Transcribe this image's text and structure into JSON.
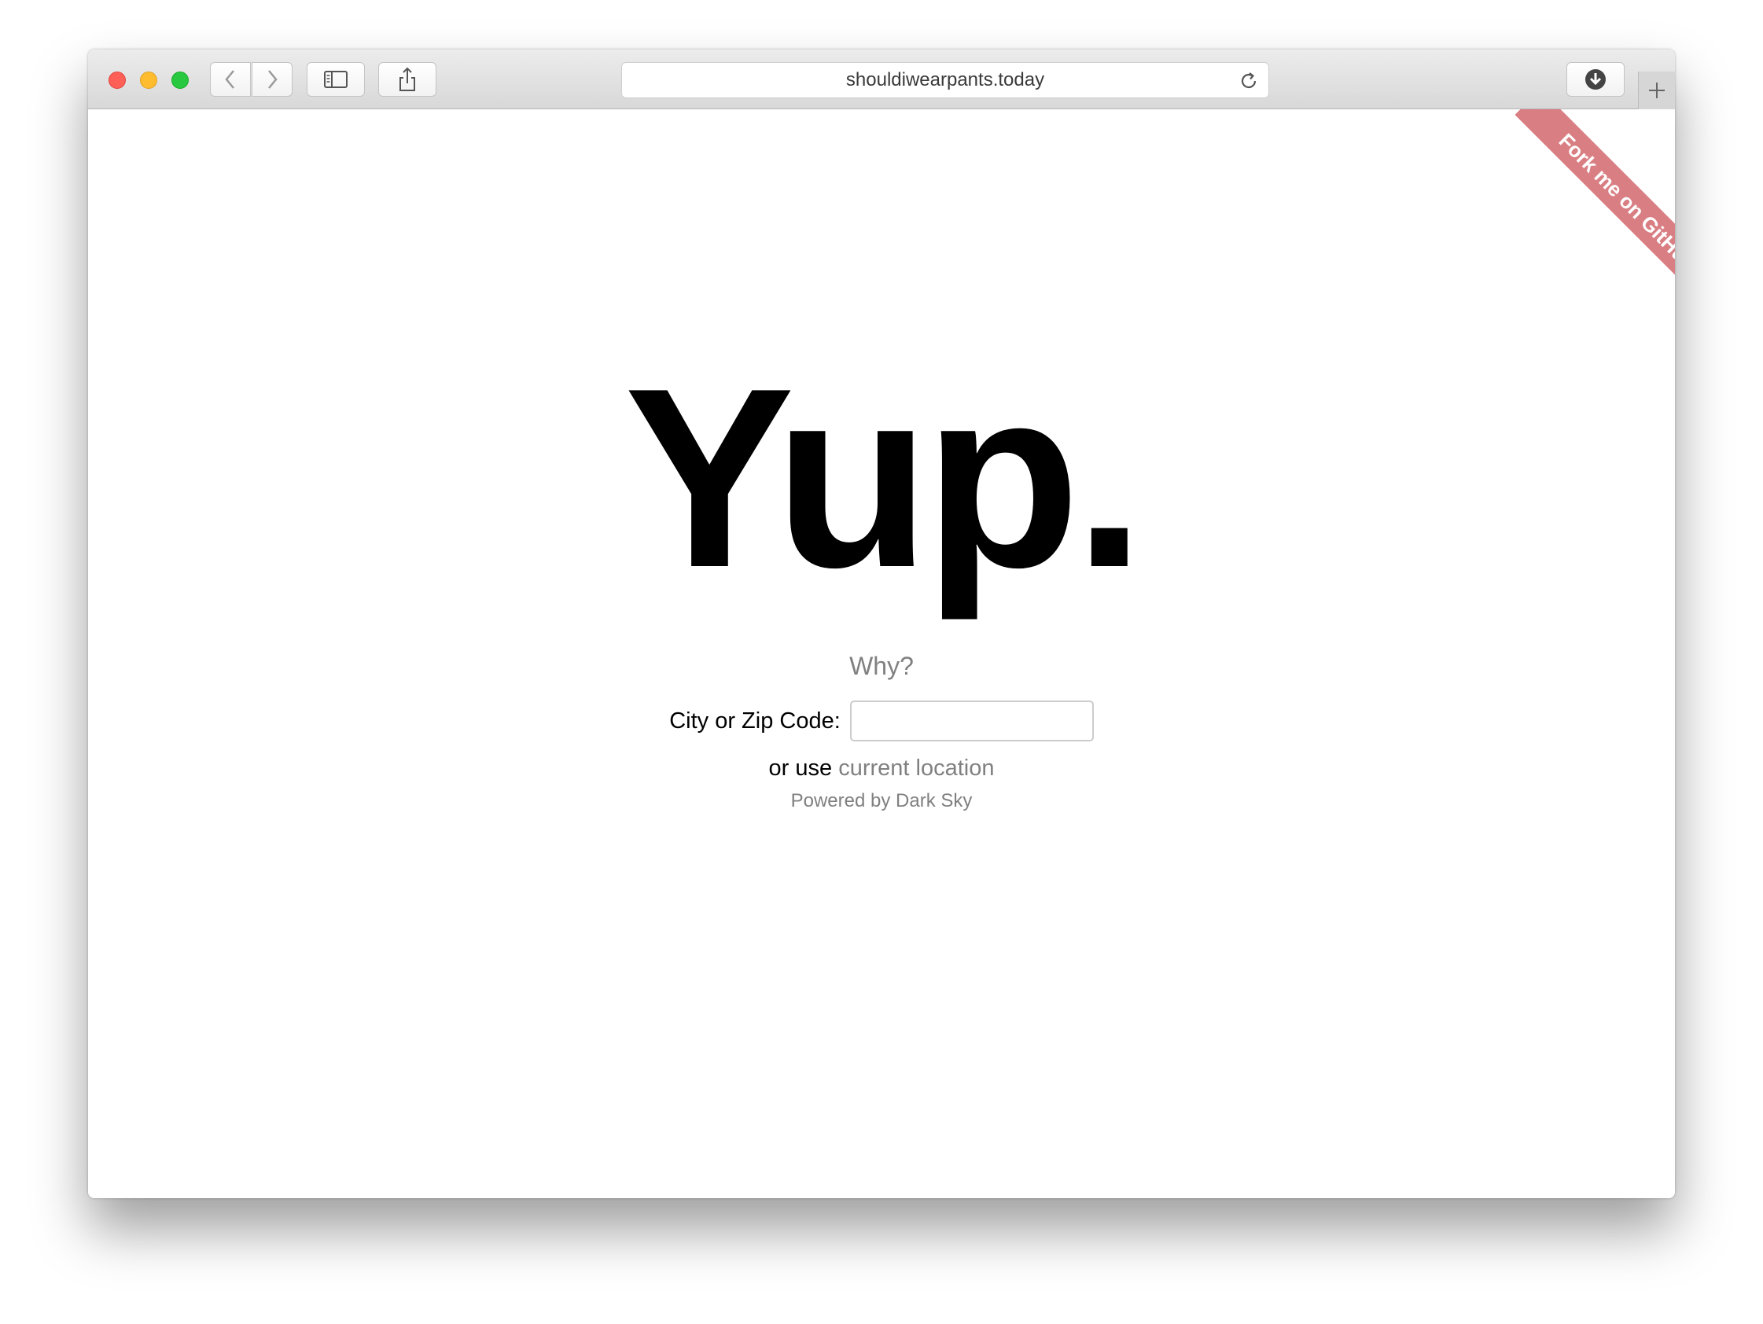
{
  "browser": {
    "url": "shouldiwearpants.today"
  },
  "page": {
    "ribbon_label": "Fork me on GitHub",
    "answer": "Yup.",
    "why_link": "Why?",
    "location_label": "City or Zip Code:",
    "location_value": "",
    "location_placeholder": "",
    "alt_prefix": "or use",
    "current_location_link": "current location",
    "powered_by": "Powered by Dark Sky"
  },
  "colors": {
    "ribbon": "#d97f84",
    "link": "#808080"
  }
}
